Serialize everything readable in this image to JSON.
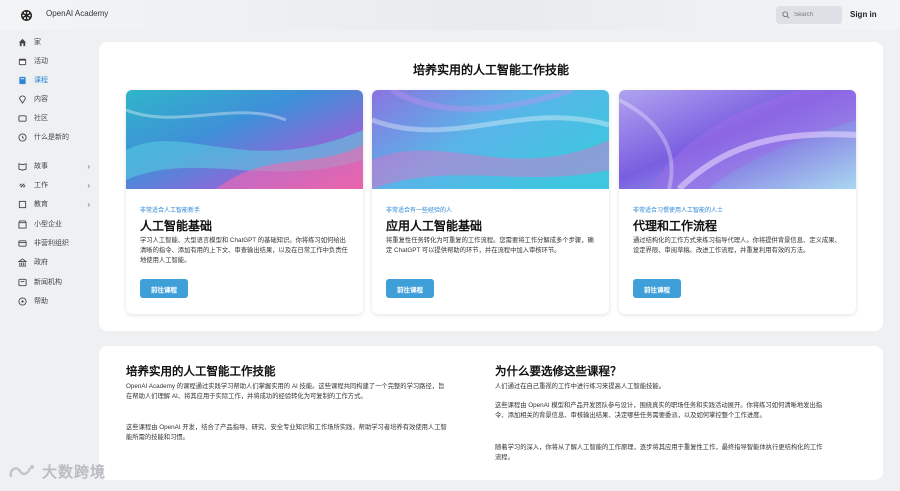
{
  "header": {
    "brand": "OpenAI Academy",
    "search_placeholder": "Search",
    "signin_label": "Sign in"
  },
  "sidebar": {
    "items": [
      {
        "label": "家",
        "icon": "home-icon"
      },
      {
        "label": "活动",
        "icon": "calendar-icon"
      },
      {
        "label": "课程",
        "icon": "book-icon",
        "active": true
      },
      {
        "label": "内容",
        "icon": "location-icon"
      },
      {
        "label": "社区",
        "icon": "community-icon"
      },
      {
        "label": "什么是新的",
        "icon": "clock-icon"
      },
      {
        "label": "故事",
        "icon": "book-open-icon",
        "chevron": true
      },
      {
        "label": "工作",
        "icon": "link-icon",
        "chevron": true
      },
      {
        "label": "教育",
        "icon": "education-icon",
        "chevron": true
      },
      {
        "label": "小型企业",
        "icon": "store-icon"
      },
      {
        "label": "非营利组织",
        "icon": "nonprofit-icon"
      },
      {
        "label": "政府",
        "icon": "government-icon"
      },
      {
        "label": "新闻机构",
        "icon": "news-icon"
      },
      {
        "label": "帮助",
        "icon": "help-icon"
      }
    ]
  },
  "main": {
    "title": "培养实用的人工智能工作技能",
    "courses": [
      {
        "tag": "非常适合人工智能新手",
        "title": "人工智能基础",
        "description": "学习人工智能、大型语言模型和 ChatGPT 的基础知识。你将练习如何给出清晰的指令、添加有用的上下文、审查输出结果，以及在日常工作中负责任地使用人工智能。",
        "button": "前往课程"
      },
      {
        "tag": "非常适合有一些经验的人",
        "title": "应用人工智能基础",
        "description": "将重复性任务转化为可重复的工作流程。您需要将工作分解成多个步骤，确定 ChatGPT 可以提供帮助的环节，并在流程中加入审核环节。",
        "button": "前往课程"
      },
      {
        "tag": "非常适合习惯使用人工智能的人士",
        "title": "代理和工作流程",
        "description": "通过结构化的工作方式来练习指导代理人。你将提供背景信息、定义成果、设定界限、审阅草稿、改进工作流程，并重复利用有效的方法。",
        "button": "前往课程"
      }
    ]
  },
  "bottom": {
    "left_title": "培养实用的人工智能工作技能",
    "left_p1": "OpenAI Academy 的课程通过实践学习帮助人们掌握实用的 AI 技能。这些课程共同构建了一个完整的学习路径，旨在帮助人们理解 AI、将其应用于实际工作，并将成功的经验转化为可复制的工作方式。",
    "left_p2": "这些课程由 OpenAI 开发，结合了产品指导、研究、安全专业知识和工作场所实践，帮助学习者培养有效使用人工智能所需的技能和习惯。",
    "right_title": "为什么要选修这些课程？",
    "right_p1": "人们通过在自己重视的工作中进行练习来提高人工智能技能。",
    "right_p2": "这些课程由 OpenAI 模型和产品开发团队参与设计，围绕真实的职场任务和实践活动展开。你将练习如何清晰地发出指令、添加相关的背景信息、审核输出结果、决定哪些任务需要委派，以及如何掌控整个工作进度。",
    "right_p3": "随着学习的深入，你将从了解人工智能的工作原理，逐步将其应用于重复性工作，最终指导智能体执行更结构化的工作流程。"
  },
  "watermark": {
    "text": "大数跨境"
  },
  "colors": {
    "accent": "#2c87d6",
    "button": "#3f9fd9",
    "page_bg": "#eef0f2"
  }
}
